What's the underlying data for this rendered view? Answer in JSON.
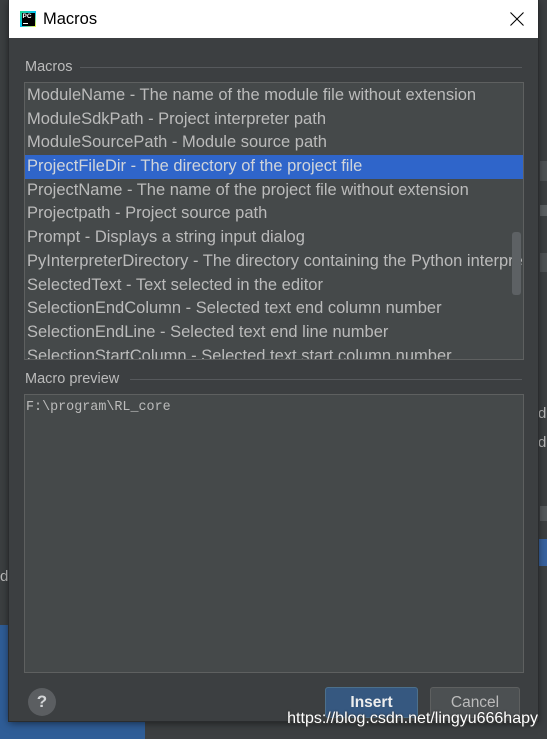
{
  "window": {
    "title": "Macros",
    "logo_text": "PC",
    "icons": {
      "app": "pycharm-logo-icon",
      "close": "close-icon"
    }
  },
  "macros_section": {
    "label": "Macros"
  },
  "macro_list": {
    "selected_index": 3,
    "items": [
      "ModuleName - The name of the module file without extension",
      "ModuleSdkPath - Project interpreter path",
      "ModuleSourcePath - Module source path",
      "ProjectFileDir - The directory of the project file",
      "ProjectName - The name of the project file without extension",
      "Projectpath - Project source path",
      "Prompt - Displays a string input dialog",
      "PyInterpreterDirectory - The directory containing the Python interpre",
      "SelectedText - Text selected in the editor",
      "SelectionEndColumn - Selected text end column number",
      "SelectionEndLine - Selected text end line number",
      "SelectionStartColumn - Selected text start column number"
    ],
    "scroll": {
      "offset_percent": 70,
      "visible_percent": 23
    }
  },
  "preview_section": {
    "label": "Macro preview",
    "value": "F:\\program\\RL_core"
  },
  "buttons": {
    "help_label": "?",
    "help_icon": "question-mark-icon",
    "insert_label": "Insert",
    "cancel_label": "Cancel"
  },
  "watermark": {
    "text": "https://blog.csdn.net/lingyu666hapy"
  },
  "parent_window": {
    "fragments": [
      "do",
      "de",
      "d"
    ]
  },
  "theme": {
    "dialog_bg": "#3c3f41",
    "title_bar_bg": "#ffffff",
    "selection_bg": "#2f65ca",
    "default_button_bg": "#365880",
    "text": "#bbbbbb"
  }
}
